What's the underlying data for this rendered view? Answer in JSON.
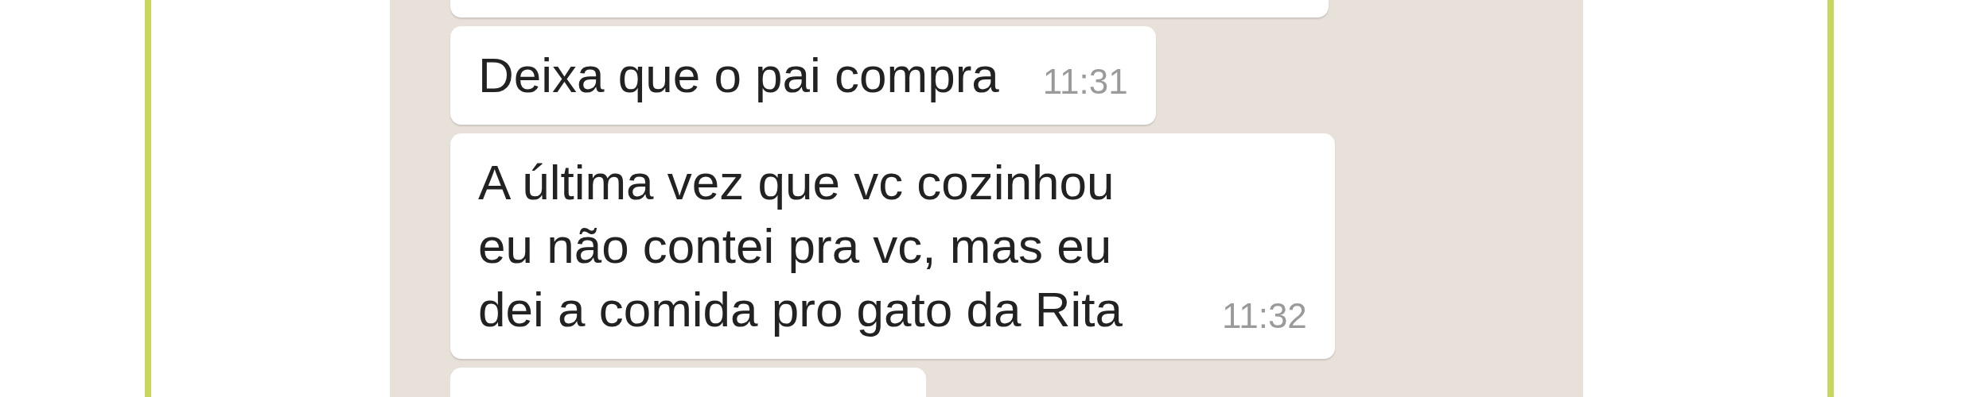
{
  "messages": [
    {
      "kind": "cut"
    },
    {
      "kind": "text",
      "text": "Deixa que o pai compra",
      "time": "11:31"
    },
    {
      "kind": "text",
      "text": "A última vez que vc cozinhou eu não contei pra vc, mas eu dei a comida pro gato da Rita",
      "time": "11:32"
    },
    {
      "kind": "cut_bottom"
    }
  ]
}
